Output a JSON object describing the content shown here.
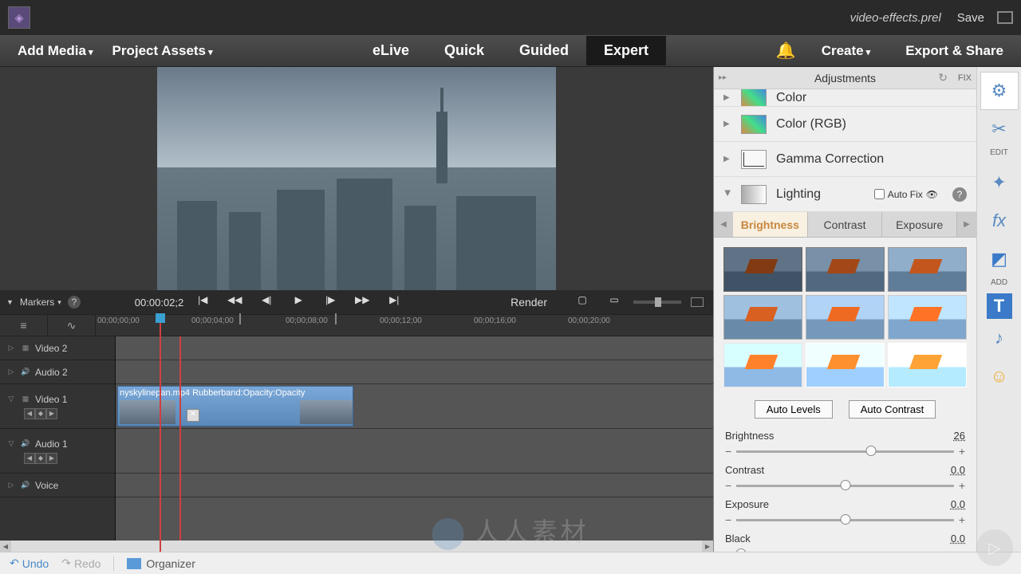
{
  "titlebar": {
    "project_name": "video-effects.prel",
    "save": "Save"
  },
  "menubar": {
    "add_media": "Add Media",
    "project_assets": "Project Assets",
    "modes": {
      "elive": "eLive",
      "quick": "Quick",
      "guided": "Guided",
      "expert": "Expert"
    },
    "create": "Create",
    "export_share": "Export & Share"
  },
  "timeline": {
    "markers": "Markers",
    "timecode": "00:00:02;2",
    "render": "Render",
    "ruler": [
      "00;00;00;00",
      "00;00;04;00",
      "00;00;08;00",
      "00;00;12;00",
      "00;00;16;00",
      "00;00;20;00"
    ],
    "tracks": {
      "video2": "Video 2",
      "audio2": "Audio 2",
      "video1": "Video 1",
      "audio1": "Audio 1",
      "voice": "Voice"
    },
    "clip_label": "nyskylinepan.mp4 Rubberband:Opacity:Opacity"
  },
  "bottom": {
    "undo": "Undo",
    "redo": "Redo",
    "organizer": "Organizer"
  },
  "adjustments": {
    "title": "Adjustments",
    "fix": "FIX",
    "categories": {
      "color": "Color",
      "color_rgb": "Color (RGB)",
      "gamma": "Gamma Correction",
      "lighting": "Lighting"
    },
    "auto_fix": "Auto Fix",
    "sub_tabs": {
      "brightness": "Brightness",
      "contrast": "Contrast",
      "exposure": "Exposure"
    },
    "auto_levels": "Auto Levels",
    "auto_contrast": "Auto Contrast",
    "sliders": {
      "brightness": {
        "label": "Brightness",
        "value": "26"
      },
      "contrast": {
        "label": "Contrast",
        "value": "0.0"
      },
      "exposure": {
        "label": "Exposure",
        "value": "0.0"
      },
      "black": {
        "label": "Black",
        "value": "0.0"
      }
    }
  },
  "right_toolbar": {
    "edit": "EDIT",
    "add": "ADD"
  }
}
